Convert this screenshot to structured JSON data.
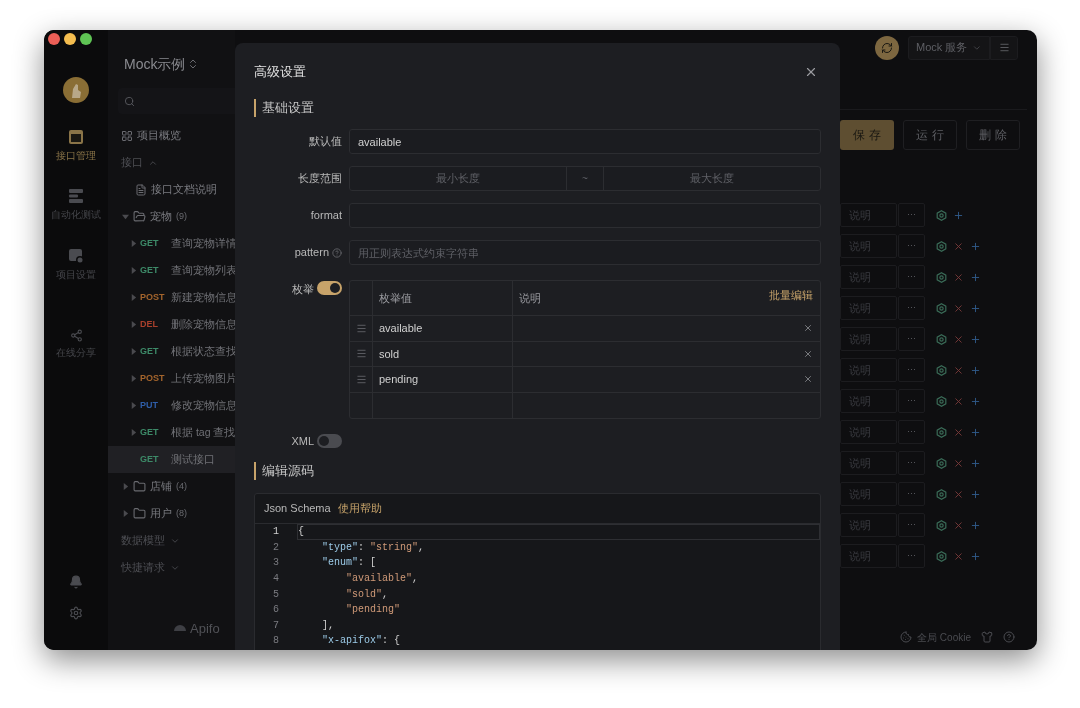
{
  "rail": {
    "items": [
      {
        "kind": "api",
        "label": "接口管理",
        "selected": true
      },
      {
        "kind": "test",
        "label": "自动化测试",
        "selected": false
      },
      {
        "kind": "settings",
        "label": "项目设置",
        "selected": false
      },
      {
        "kind": "share",
        "label": "在线分享",
        "selected": false
      }
    ]
  },
  "sidebar": {
    "title": "Mock示例",
    "items": [
      {
        "kind": "overview",
        "label": "项目概览"
      },
      {
        "kind": "section",
        "label": "接口",
        "expanded": true,
        "children": [
          {
            "kind": "doc",
            "label": "接口文档说明"
          },
          {
            "kind": "folder",
            "label": "宠物",
            "count": "(9)",
            "expanded": true,
            "children": [
              {
                "kind": "endpoint",
                "method": "GET",
                "color": "#3d8a68",
                "label": "查询宠物详情",
                "expanded": false,
                "selected": false
              },
              {
                "kind": "endpoint",
                "method": "GET",
                "color": "#3d8a68",
                "label": "查询宠物列表",
                "expanded": false,
                "selected": false
              },
              {
                "kind": "endpoint",
                "method": "POST",
                "color": "#a3642c",
                "label": "新建宠物信息",
                "expanded": false,
                "selected": false
              },
              {
                "kind": "endpoint",
                "method": "DEL",
                "color": "#a8402c",
                "label": "删除宠物信息",
                "expanded": false,
                "selected": false
              },
              {
                "kind": "endpoint",
                "method": "GET",
                "color": "#3d8a68",
                "label": "根据状态查找",
                "expanded": false,
                "selected": false
              },
              {
                "kind": "endpoint",
                "method": "POST",
                "color": "#a3642c",
                "label": "上传宠物图片",
                "expanded": false,
                "selected": false
              },
              {
                "kind": "endpoint",
                "method": "PUT",
                "color": "#2f5ea8",
                "label": "修改宠物信息",
                "expanded": false,
                "selected": false
              },
              {
                "kind": "endpoint",
                "method": "GET",
                "color": "#3d8a68",
                "label": "根据 tag 查找",
                "expanded": false,
                "selected": false
              },
              {
                "kind": "endpoint",
                "method": "GET",
                "color": "#3d8a68",
                "label": "测试接口",
                "selected": true
              }
            ]
          },
          {
            "kind": "folder",
            "label": "店铺",
            "count": "(4)",
            "expanded": false
          },
          {
            "kind": "folder",
            "label": "用户",
            "count": "(8)",
            "expanded": false
          }
        ]
      },
      {
        "kind": "section",
        "label": "数据模型",
        "expanded": false
      },
      {
        "kind": "section",
        "label": "快捷请求",
        "expanded": false
      }
    ],
    "brand": "Apifo"
  },
  "toolbar": {
    "mock_service": "Mock 服务",
    "buttons": [
      {
        "label": "保存",
        "kind": "primary"
      },
      {
        "label": "运行",
        "kind": "default"
      },
      {
        "label": "删除",
        "kind": "default"
      }
    ]
  },
  "params_rows": [
    {
      "placeholder": "说明",
      "more": "···",
      "removable": false
    },
    {
      "placeholder": "说明",
      "more": "···",
      "removable": true
    },
    {
      "placeholder": "说明",
      "more": "···",
      "removable": true
    },
    {
      "placeholder": "说明",
      "more": "···",
      "removable": true
    },
    {
      "placeholder": "说明",
      "more": "···",
      "removable": true
    },
    {
      "placeholder": "说明",
      "more": "···",
      "removable": true
    },
    {
      "placeholder": "说明",
      "more": "···",
      "removable": true
    },
    {
      "placeholder": "说明",
      "more": "···",
      "removable": true
    },
    {
      "placeholder": "说明",
      "more": "···",
      "removable": true
    },
    {
      "placeholder": "说明",
      "more": "···",
      "removable": true
    },
    {
      "placeholder": "说明",
      "more": "···",
      "removable": true
    },
    {
      "placeholder": "说明",
      "more": "···",
      "removable": true
    }
  ],
  "status_bar": {
    "cookie": "全局 Cookie"
  },
  "dialog": {
    "title": "高级设置",
    "basic": {
      "heading": "基础设置",
      "default_value": {
        "label": "默认值",
        "value": "available"
      },
      "length_range": {
        "label": "长度范围",
        "min_placeholder": "最小长度",
        "separator": "~",
        "max_placeholder": "最大长度"
      },
      "format": {
        "label": "format"
      },
      "pattern": {
        "label": "pattern",
        "placeholder": "用正则表达式约束字符串"
      },
      "enum": {
        "label": "枚举",
        "on": true,
        "columns": [
          "枚举值",
          "说明"
        ],
        "batch_edit": "批量编辑",
        "rows": [
          {
            "value": "available"
          },
          {
            "value": "sold"
          },
          {
            "value": "pending"
          }
        ]
      },
      "xml": {
        "label": "XML",
        "on": false
      }
    },
    "source": {
      "heading": "编辑源码",
      "tab": "Json Schema",
      "help_link": "使用帮助",
      "lines": [
        {
          "number": "1",
          "tokens": [
            {
              "kind": "punct",
              "text": "{"
            }
          ]
        },
        {
          "number": "2",
          "tokens": [
            {
              "kind": "key",
              "text": "    \"type\""
            },
            {
              "kind": "punct",
              "text": ": "
            },
            {
              "kind": "string",
              "text": "\"string\""
            },
            {
              "kind": "punct",
              "text": ","
            }
          ]
        },
        {
          "number": "3",
          "tokens": [
            {
              "kind": "key",
              "text": "    \"enum\""
            },
            {
              "kind": "punct",
              "text": ": ["
            }
          ]
        },
        {
          "number": "4",
          "tokens": [
            {
              "kind": "string",
              "text": "        \"available\""
            },
            {
              "kind": "punct",
              "text": ","
            }
          ]
        },
        {
          "number": "5",
          "tokens": [
            {
              "kind": "string",
              "text": "        \"sold\""
            },
            {
              "kind": "punct",
              "text": ","
            }
          ]
        },
        {
          "number": "6",
          "tokens": [
            {
              "kind": "string",
              "text": "        \"pending\""
            }
          ]
        },
        {
          "number": "7",
          "tokens": [
            {
              "kind": "punct",
              "text": "    ],"
            }
          ]
        },
        {
          "number": "8",
          "tokens": [
            {
              "kind": "key",
              "text": "    \"x-apifox\""
            },
            {
              "kind": "punct",
              "text": ": {"
            }
          ]
        }
      ]
    }
  }
}
